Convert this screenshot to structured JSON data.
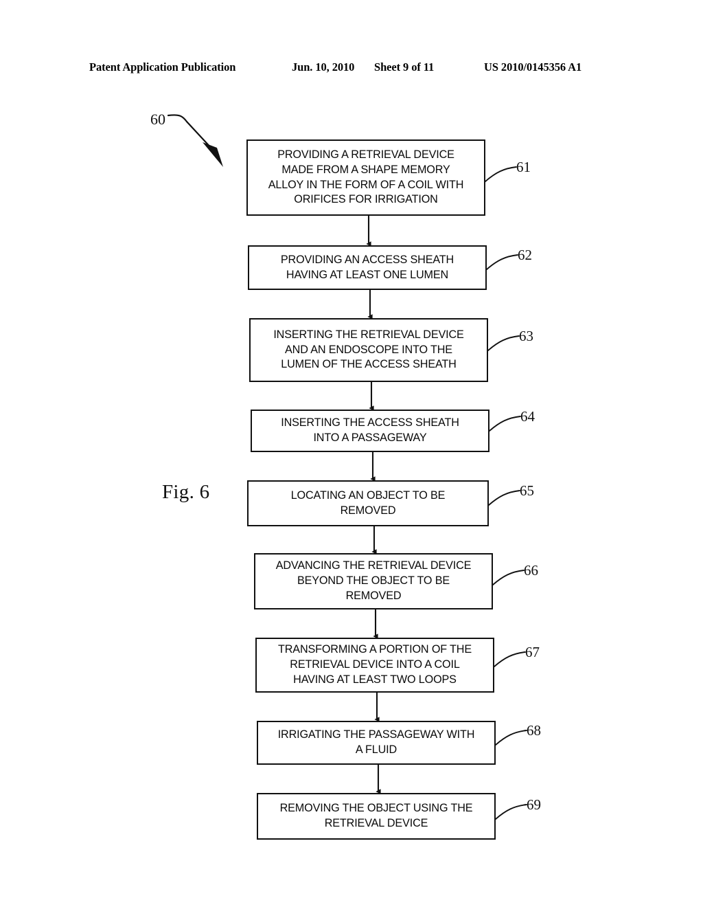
{
  "header": {
    "publication": "Patent Application Publication",
    "date": "Jun. 10, 2010",
    "sheet": "Sheet 9 of 11",
    "patent_number": "US 2010/0145356 A1"
  },
  "figure": {
    "caption": "Fig. 6",
    "diagram_ref": "60",
    "type": "flowchart",
    "orientation": "top-to-bottom"
  },
  "flowchart": {
    "steps": [
      {
        "ref": "61",
        "text": "PROVIDING A RETRIEVAL DEVICE\nMADE FROM A SHAPE MEMORY\nALLOY IN THE FORM OF A COIL WITH\nORIFICES FOR IRRIGATION"
      },
      {
        "ref": "62",
        "text": "PROVIDING AN ACCESS SHEATH\nHAVING AT LEAST ONE LUMEN"
      },
      {
        "ref": "63",
        "text": "INSERTING THE RETRIEVAL DEVICE\nAND AN ENDOSCOPE INTO THE\nLUMEN OF THE ACCESS SHEATH"
      },
      {
        "ref": "64",
        "text": "INSERTING THE ACCESS SHEATH\nINTO A PASSAGEWAY"
      },
      {
        "ref": "65",
        "text": "LOCATING AN OBJECT TO BE\nREMOVED"
      },
      {
        "ref": "66",
        "text": "ADVANCING THE RETRIEVAL DEVICE\nBEYOND THE OBJECT TO BE\nREMOVED"
      },
      {
        "ref": "67",
        "text": "TRANSFORMING A PORTION OF THE\nRETRIEVAL DEVICE INTO A COIL\nHAVING AT LEAST TWO LOOPS"
      },
      {
        "ref": "68",
        "text": "IRRIGATING THE PASSAGEWAY WITH\nA FLUID"
      },
      {
        "ref": "69",
        "text": "REMOVING THE OBJECT USING THE\nRETRIEVAL DEVICE"
      }
    ]
  },
  "colors": {
    "ink": "#111111",
    "paper": "#ffffff"
  }
}
